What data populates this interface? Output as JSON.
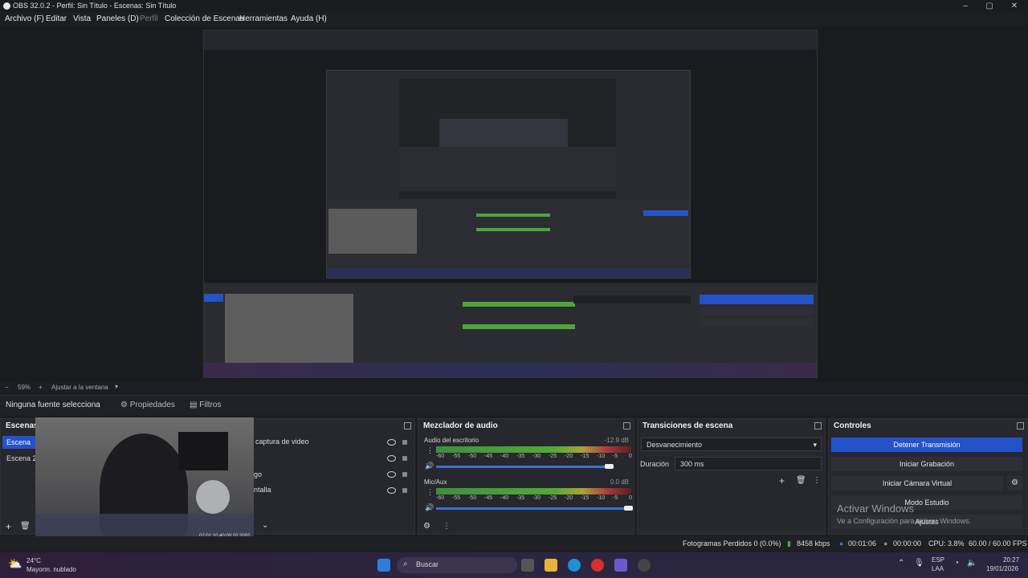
{
  "window": {
    "title": "OBS 32.0.2 - Perfil: Sin Título - Escenas: Sin Título"
  },
  "menu": [
    {
      "label": "Archivo (F)"
    },
    {
      "label": "Editar"
    },
    {
      "label": "Vista"
    },
    {
      "label": "Paneles (D)"
    },
    {
      "label": "Perfil",
      "disabled": true
    },
    {
      "label": "Colección de Escenas"
    },
    {
      "label": "Herramientas"
    },
    {
      "label": "Ayuda (H)"
    }
  ],
  "zoom": {
    "percent": "59%",
    "fit_label": "Ajustar a la ventana"
  },
  "source_bar": {
    "no_source": "Ninguna fuente selecciona",
    "properties": "Propiedades",
    "filters": "Filtros"
  },
  "scenes": {
    "title": "Escenas",
    "items": [
      {
        "label": "Escena"
      },
      {
        "label": "Escena 2"
      }
    ]
  },
  "sources": {
    "items": [
      {
        "label": "captura de video"
      },
      {
        "label": ""
      },
      {
        "label": "go"
      },
      {
        "label": "ntalla"
      }
    ],
    "webcam_caption": "02:01:10 40:00:10 2002"
  },
  "mixer": {
    "title": "Mezclador de audio",
    "channels": [
      {
        "name": "Audio del escritorio",
        "db": "-12.9 dB",
        "level": 0.9
      },
      {
        "name": "Mic/Aux",
        "db": "0.0 dB",
        "level": 1.0
      }
    ],
    "ticks": [
      "-60",
      "-55",
      "-50",
      "-45",
      "-40",
      "-35",
      "-30",
      "-25",
      "-20",
      "-15",
      "-10",
      "-5",
      "0"
    ]
  },
  "transitions": {
    "title": "Transiciones de escena",
    "selected": "Desvanecimiento",
    "duration_label": "Duración",
    "duration_value": "300 ms"
  },
  "controls": {
    "title": "Controles",
    "stop_stream": "Detener Transmisión",
    "start_recording": "Iniciar Grabación",
    "start_virtual_cam": "Iniciar Cámara Virtual",
    "studio_mode": "Modo Estudio",
    "settings": "Ajustes"
  },
  "activation": {
    "line1": "Activar Windows",
    "line2": "Ve a Configuración para activar Windows."
  },
  "status": {
    "dropped": "Fotogramas Perdidos 0 (0.0%)",
    "bitrate": "8458 kbps",
    "stream_time": "00:01:06",
    "rec_time": "00:00:00",
    "cpu": "CPU: 3.8%",
    "fps": "60.00 / 60.00 FPS"
  },
  "taskbar": {
    "weather_temp": "24°C",
    "weather_desc": "Mayorm. nublado",
    "search": "Buscar",
    "lang1": "ESP",
    "lang2": "LAA",
    "time": "20:27",
    "date": "19/01/2026"
  },
  "colors": {
    "accent": "#2452c9",
    "panel": "#27282d",
    "background": "#1d1e22"
  }
}
